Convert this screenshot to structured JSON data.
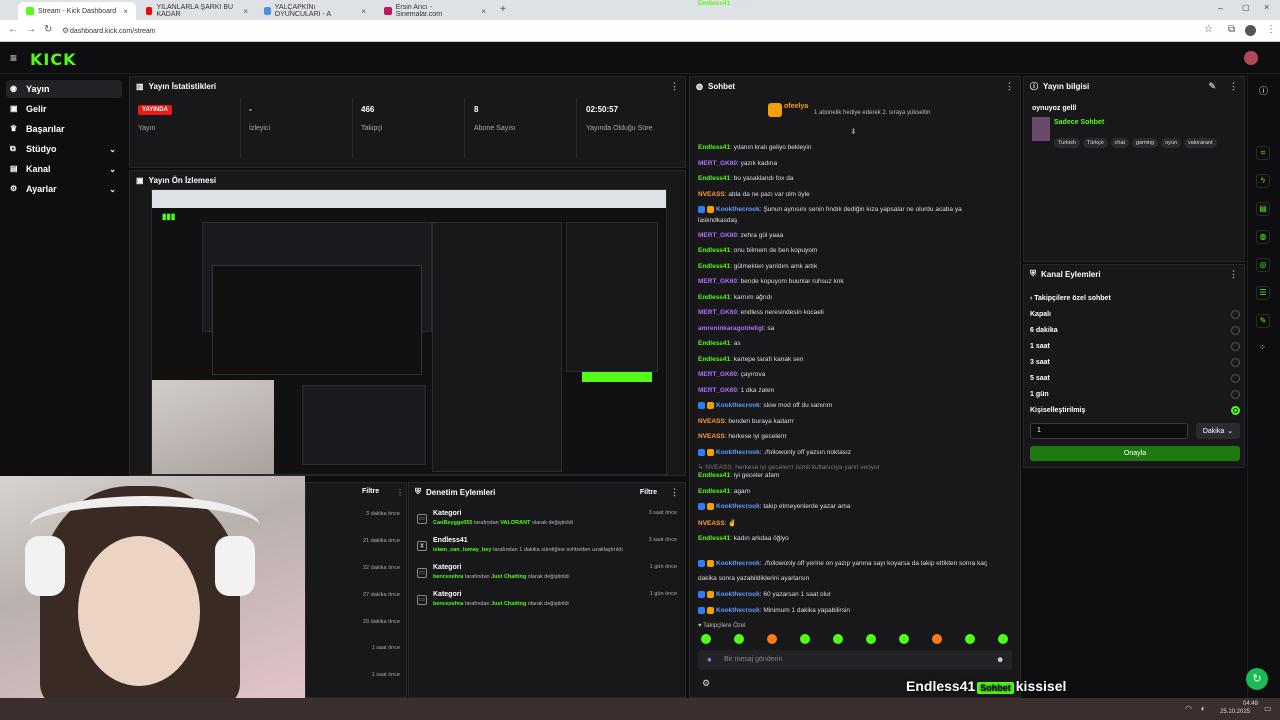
{
  "browser": {
    "tabs": [
      {
        "label": "Stream - Kick Dashboard",
        "active": true
      },
      {
        "label": "YILANLARLA ŞARKI BU KADAR"
      },
      {
        "label": "YALÇAPKINı OYUNCULARI - A"
      },
      {
        "label": "Ersin Arıcı - Sinemalar.com"
      }
    ],
    "url": "dashboard.kick.com/stream"
  },
  "app": {
    "logo": "KICK"
  },
  "sidebar": {
    "items": [
      {
        "label": "Yayın",
        "icon": "broadcast-icon",
        "active": true
      },
      {
        "label": "Gelir",
        "icon": "wallet-icon"
      },
      {
        "label": "Başarılar",
        "icon": "trophy-icon"
      },
      {
        "label": "Stüdyo",
        "icon": "studio-icon",
        "expandable": true
      },
      {
        "label": "Kanal",
        "icon": "channel-icon",
        "expandable": true
      },
      {
        "label": "Ayarlar",
        "icon": "gear-icon",
        "expandable": true
      }
    ]
  },
  "stats": {
    "title": "Yayın İstatistikleri",
    "live_badge": "YAYINDA",
    "live_label": "Yayın",
    "viewers_value": "-",
    "viewers_label": "İzleyici",
    "followers_value": "466",
    "followers_label": "Takipçi",
    "subs_value": "8",
    "subs_label": "Abone Sayısı",
    "uptime_value": "02:50:57",
    "uptime_label": "Yayında Olduğu Süre"
  },
  "preview": {
    "title": "Yayın Ön İzlemesi"
  },
  "chat": {
    "title": "Sohbet",
    "pinned_user": "ofeelya",
    "pinned_text": "1 abonelik hediye ederek 2. sıraya yükseltin",
    "messages": [
      {
        "user": "Endless41",
        "color": "g",
        "text": "yılanın kralı geliyo bekleyin"
      },
      {
        "user": "MERT_GK60",
        "color": "p",
        "text": "yazık kadına"
      },
      {
        "user": "Endless41",
        "color": "g",
        "text": "bu yasaklandı fox da"
      },
      {
        "user": "NVEASS",
        "color": "o",
        "text": "abla da ne pazı var olm öyle"
      },
      {
        "user": "Kookthecrook",
        "color": "b",
        "badges": true,
        "text": "Şunun aynısını senin fındık dediğin kıza yapsalar ne olurdu acaba ya"
      },
      {
        "user": "",
        "color": "g",
        "text": "laskndkasdaş"
      },
      {
        "user": "MERT_GK60",
        "color": "p",
        "text": "zehra gül yaaa"
      },
      {
        "user": "Endless41",
        "color": "g",
        "text": "onu bilmem de ben kopuyom"
      },
      {
        "user": "Endless41",
        "color": "g",
        "text": "gülmekten yarıldım amk artık"
      },
      {
        "user": "MERT_GK60",
        "color": "p",
        "text": "bende kopuyom buunlar ruhsuz knk"
      },
      {
        "user": "Endless41",
        "color": "g",
        "text": "karnım ağrıdı"
      },
      {
        "user": "MERT_GK60",
        "color": "p",
        "text": "endless neresindesin kocaeli"
      },
      {
        "user": "amreninkaragotdeligi",
        "color": "p",
        "text": "sa"
      },
      {
        "user": "Endless41",
        "color": "g",
        "text": "as"
      },
      {
        "user": "Endless41",
        "color": "g",
        "text": "kartepe tarafı kanak sen"
      },
      {
        "user": "MERT_GK60",
        "color": "p",
        "text": "çayırova"
      },
      {
        "user": "MERT_GK60",
        "color": "p",
        "text": "1 dka zaten"
      },
      {
        "user": "Kookthecrook",
        "color": "b",
        "badges": true,
        "text": "slow mod off du sanırım"
      },
      {
        "user": "NVEASS",
        "color": "o",
        "text": "benden buraya kadarrr"
      },
      {
        "user": "NVEASS",
        "color": "o",
        "text": "herkese iyi gecelerrr"
      },
      {
        "user": "Kookthecrook",
        "color": "b",
        "badges": true,
        "text": "./followonly off yazsın noktasız"
      },
      {
        "user": "",
        "color": "g",
        "text": "↳ NVEASS: herkese iyi gecelerrr isimli kullanıcıya yanıt veriyor"
      },
      {
        "user": "Endless41",
        "color": "g",
        "text": "iyi geceler afam"
      },
      {
        "user": "Endless41",
        "color": "g",
        "text": "agam"
      },
      {
        "user": "Kookthecrook",
        "color": "b",
        "badges": true,
        "text": "takip etmeyenlerde yazar ama"
      },
      {
        "user": "NVEASS",
        "color": "o",
        "text": "✌"
      },
      {
        "user": "Endless41",
        "color": "g",
        "text": "kadın arkdaa öğlyo"
      },
      {
        "user": "Kookthecrook",
        "color": "b",
        "badges": true,
        "text": "./followonly off yerine on yazıp yanına sayı koyarsa da takip ettikten sonra kaç"
      },
      {
        "user": "",
        "color": "g",
        "text": "dakika sonra yazabildiklerini ayarlarsın"
      },
      {
        "user": "Kookthecrook",
        "color": "b",
        "badges": true,
        "text": "60 yazarsan 1 saat olur"
      },
      {
        "user": "Kookthecrook",
        "color": "b",
        "badges": true,
        "text": "Minimum 1 dakika yapabilirsin"
      },
      {
        "user": "Endless41",
        "color": "g",
        "text": "kissisel"
      }
    ],
    "followers_only_label": "Takipçilere Özel",
    "input_placeholder": "Bir mesaj gönderin",
    "overlay_user": "Endless41",
    "overlay_text": "kissisel"
  },
  "stream_info": {
    "title": "Yayın bilgisi",
    "stream_title": "oynuyoz gelll",
    "category": "Sadece Sohbet",
    "tags": [
      "Turkish",
      "Türkçe",
      "chat",
      "gaming",
      "oyun",
      "valorarant"
    ]
  },
  "channel_actions": {
    "title": "Kanal Eylemleri",
    "subtitle": "Takipçilere özel sohbet",
    "options": [
      {
        "label": "Kapalı",
        "selected": false
      },
      {
        "label": "6 dakika",
        "selected": false
      },
      {
        "label": "1 saat",
        "selected": false
      },
      {
        "label": "3 saat",
        "selected": false
      },
      {
        "label": "5 saat",
        "selected": false
      },
      {
        "label": "1 gün",
        "selected": false
      },
      {
        "label": "Kişiselleştirilmiş",
        "selected": true
      }
    ],
    "custom_value": "1",
    "unit": "Dakika",
    "confirm": "Onayla"
  },
  "left_list": {
    "filter": "Filtre",
    "times": [
      "3 dakika önce",
      "21 dakika önce",
      "22 dakika önce",
      "27 dakika önce",
      "29 dakika önce",
      "1 saat önce",
      "1 saat önce"
    ]
  },
  "mod_events": {
    "title": "Denetim Eylemleri",
    "filter": "Filtre",
    "rows": [
      {
        "title": "Kategori",
        "user": "CanBeyggs055",
        "mid": "tarafından",
        "target": "VALORANT",
        "end": "olarak değiştirildi",
        "time": "3 saat önce"
      },
      {
        "title": "Endless41",
        "user": "islam_can_tomay_bey",
        "mid": "tarafından 1 dakika süreliğine sohbetten uzaklaştırıldı",
        "target": "",
        "end": "",
        "time": "3 saat önce"
      },
      {
        "title": "Kategori",
        "user": "bencezehra",
        "mid": "tarafından",
        "target": "Just Chatting",
        "end": "olarak değiştirildi",
        "time": "1 gün önce"
      },
      {
        "title": "Kategori",
        "user": "bencezehra",
        "mid": "tarafından",
        "target": "Just Chatting",
        "end": "olarak değiştirildi",
        "time": "1 gün önce"
      }
    ]
  },
  "taskbar": {
    "time": "04:48",
    "date": "25.10.2025"
  }
}
